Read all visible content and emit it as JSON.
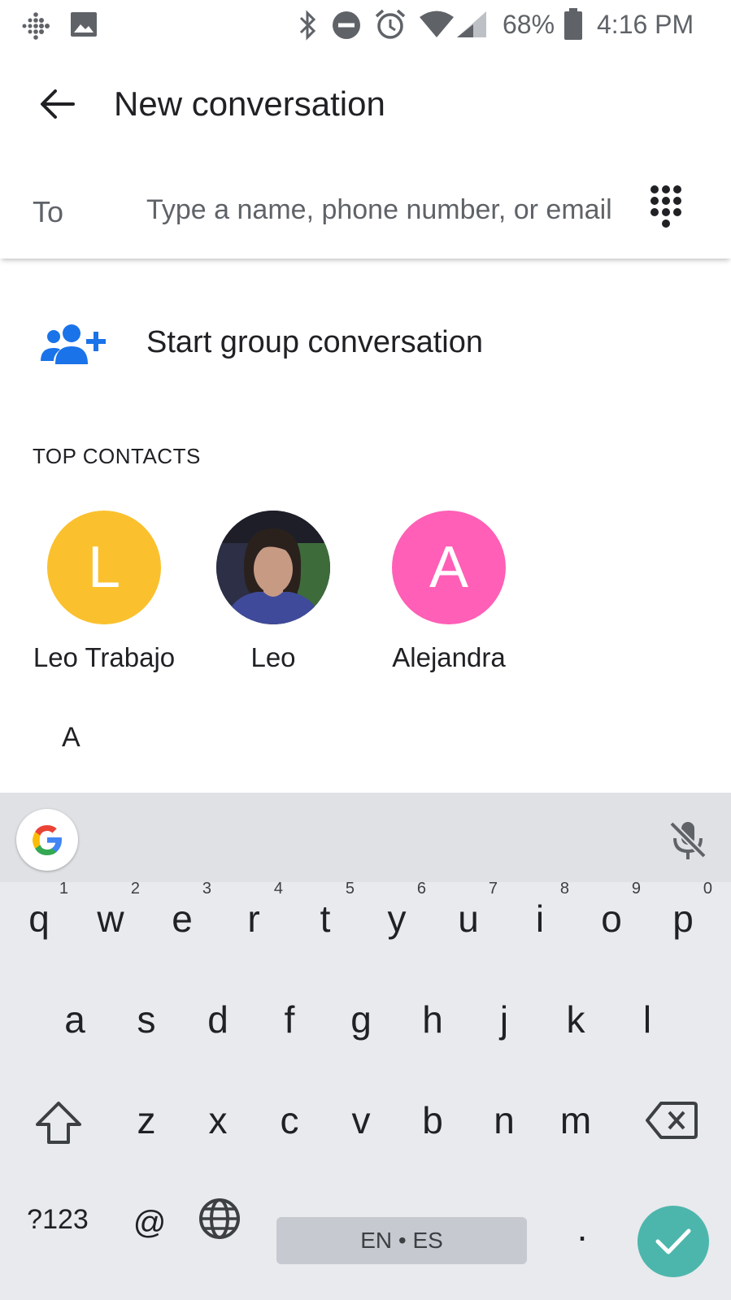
{
  "status_bar": {
    "battery": "68%",
    "time": "4:16 PM",
    "icons": [
      "fitbit-icon",
      "image-icon",
      "bluetooth-icon",
      "do-not-disturb-icon",
      "alarm-icon",
      "wifi-icon",
      "cell-signal-icon",
      "battery-icon"
    ]
  },
  "app_bar": {
    "title": "New conversation"
  },
  "to_field": {
    "label": "To",
    "placeholder": "Type a name, phone number, or email"
  },
  "group": {
    "label": "Start group conversation",
    "color": "#1a73e8"
  },
  "top_contacts": {
    "header": "TOP CONTACTS",
    "items": [
      {
        "name": "Leo Trabajo",
        "initial": "L",
        "color": "#fbc02d"
      },
      {
        "name": "Leo",
        "initial": "",
        "color": "#4a4f7a"
      },
      {
        "name": "Alejandra",
        "initial": "A",
        "color": "#ff5fb6"
      }
    ]
  },
  "section_letter": "A",
  "keyboard": {
    "row1": [
      {
        "key": "q",
        "hint": "1"
      },
      {
        "key": "w",
        "hint": "2"
      },
      {
        "key": "e",
        "hint": "3"
      },
      {
        "key": "r",
        "hint": "4"
      },
      {
        "key": "t",
        "hint": "5"
      },
      {
        "key": "y",
        "hint": "6"
      },
      {
        "key": "u",
        "hint": "7"
      },
      {
        "key": "i",
        "hint": "8"
      },
      {
        "key": "o",
        "hint": "9"
      },
      {
        "key": "p",
        "hint": "0"
      }
    ],
    "row2": [
      "a",
      "s",
      "d",
      "f",
      "g",
      "h",
      "j",
      "k",
      "l"
    ],
    "row3": [
      "z",
      "x",
      "c",
      "v",
      "b",
      "n",
      "m"
    ],
    "symbols_label": "?123",
    "at_label": "@",
    "space_label": "EN • ES",
    "period_label": ".",
    "accent": "#4db6ac"
  }
}
